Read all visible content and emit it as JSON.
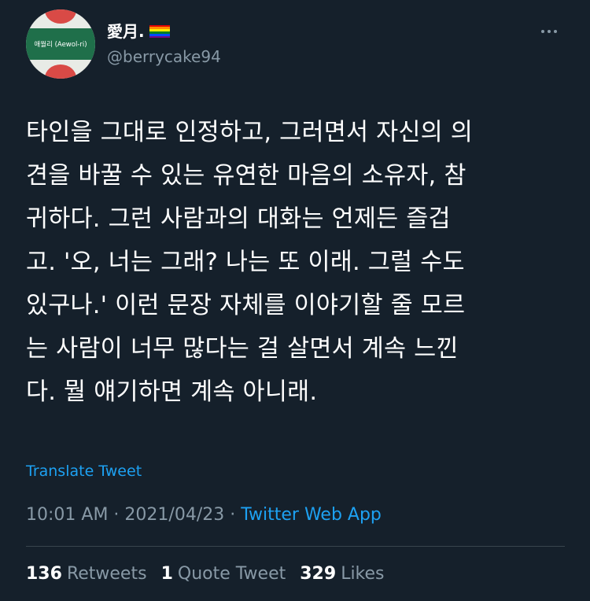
{
  "author": {
    "display_name": "愛月.",
    "handle": "@berrycake94",
    "avatar_text": "애월리 (Aewol-ri)",
    "badge_icon": "rainbow-flag-icon",
    "flag_colors": [
      "#e40303",
      "#ff8c00",
      "#ffed00",
      "#008026",
      "#004dff",
      "#750787"
    ]
  },
  "menu_icon": "more-icon",
  "tweet": {
    "lines": [
      "타인을 그대로 인정하고, 그러면서 자신의 의",
      "견을 바꿀 수 있는 유연한 마음의 소유자, 참",
      "귀하다. 그런 사람과의 대화는 언제든 즐겁",
      "고. '오, 너는 그래? 나는 또 이래. 그럴 수도",
      "있구나.' 이런 문장 자체를 이야기할 줄 모르",
      "는 사람이 너무 많다는 걸 살면서 계속 느낀",
      "다. 뭘 얘기하면 계속 아니래."
    ]
  },
  "translate_label": "Translate Tweet",
  "meta": {
    "time": "10:01 AM",
    "separator": " · ",
    "date": "2021/04/23",
    "source": "Twitter Web App"
  },
  "stats": {
    "retweets_count": "136",
    "retweets_label": "Retweets",
    "quotes_count": "1",
    "quotes_label": "Quote Tweet",
    "likes_count": "329",
    "likes_label": "Likes"
  },
  "colors": {
    "background": "#15202b",
    "accent": "#1da1f2",
    "secondary_text": "#8899a6",
    "divider": "#38444d"
  }
}
